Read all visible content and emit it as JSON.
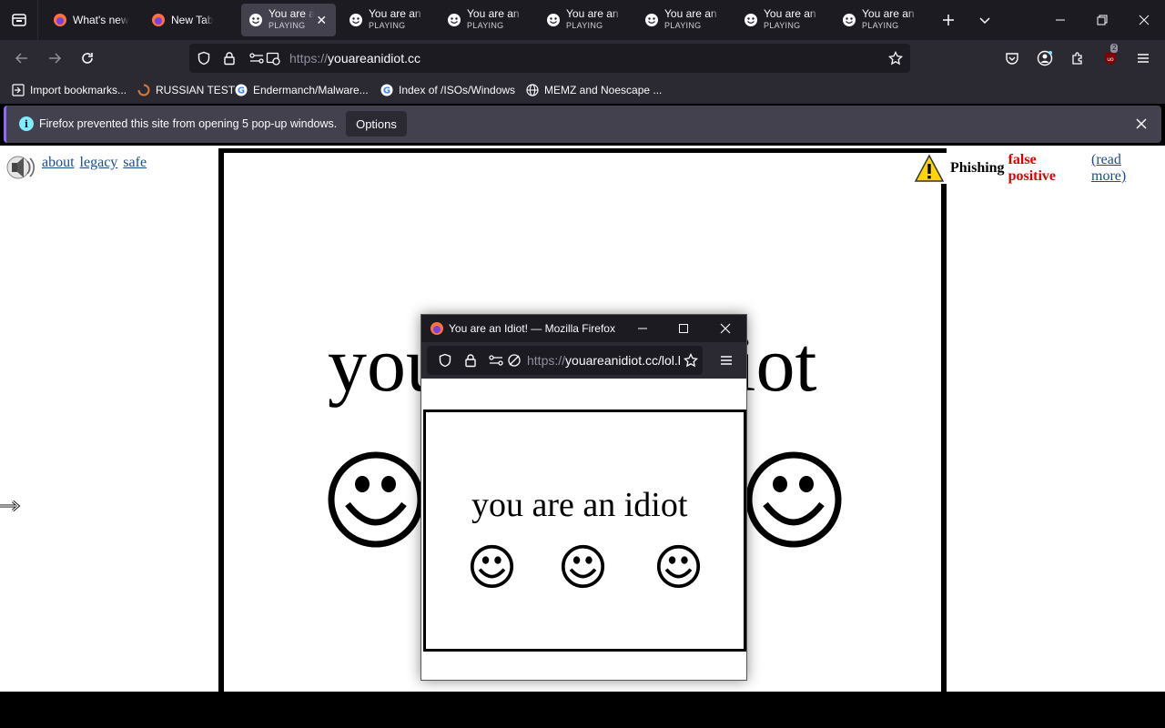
{
  "tabs": [
    {
      "title": "What's new",
      "subtitle": "",
      "icon": "firefox-icon",
      "selected": false
    },
    {
      "title": "New Tab",
      "subtitle": "",
      "icon": "firefox-icon",
      "selected": false
    },
    {
      "title": "You are an Idiot!",
      "subtitle": "PLAYING",
      "icon": "smiley-icon",
      "selected": true
    },
    {
      "title": "You are an Idiot!",
      "subtitle": "PLAYING",
      "icon": "smiley-icon",
      "selected": false
    },
    {
      "title": "You are an Idiot!",
      "subtitle": "PLAYING",
      "icon": "smiley-icon",
      "selected": false
    },
    {
      "title": "You are an Idiot!",
      "subtitle": "PLAYING",
      "icon": "smiley-icon",
      "selected": false
    },
    {
      "title": "You are an Idiot!",
      "subtitle": "PLAYING",
      "icon": "smiley-icon",
      "selected": false
    },
    {
      "title": "You are an Idiot!",
      "subtitle": "PLAYING",
      "icon": "smiley-icon",
      "selected": false
    },
    {
      "title": "You are an Idiot!",
      "subtitle": "PLAYING",
      "icon": "smiley-icon",
      "selected": false
    }
  ],
  "urlbar": {
    "scheme": "https://",
    "host": "youareanidiot.cc"
  },
  "toolbar": {
    "extension_badge": "2"
  },
  "bookmarks": [
    {
      "label": "Import bookmarks...",
      "icon": "import-icon"
    },
    {
      "label": "RUSSIAN TEST",
      "icon": "loading-icon"
    },
    {
      "label": "Endermanch/Malware...",
      "icon": "google-icon"
    },
    {
      "label": "Index of /ISOs/Windows",
      "icon": "google-icon"
    },
    {
      "label": "MEMZ and Noescape ...",
      "icon": "globe-icon"
    }
  ],
  "notification": {
    "message": "Firefox prevented this site from opening 5 pop-up windows.",
    "options_label": "Options"
  },
  "page": {
    "links": [
      "about",
      "legacy",
      "safe"
    ],
    "phishing_label": "Phishing",
    "false_positive_label": "false positive",
    "read_more_label": "(read more)",
    "headline": "you are an idiot"
  },
  "popup": {
    "window_title": "You are an Idiot! — Mozilla Firefox",
    "url_scheme": "https://",
    "url_rest": "youareanidiot.cc/lol.html",
    "headline": "you are an idiot"
  },
  "colors": {
    "accent": "#8f69ff",
    "chrome_dark": "#1c1b22",
    "chrome": "#2b2a33",
    "warning_red": "#e00000",
    "link": "#1a4d8c"
  }
}
